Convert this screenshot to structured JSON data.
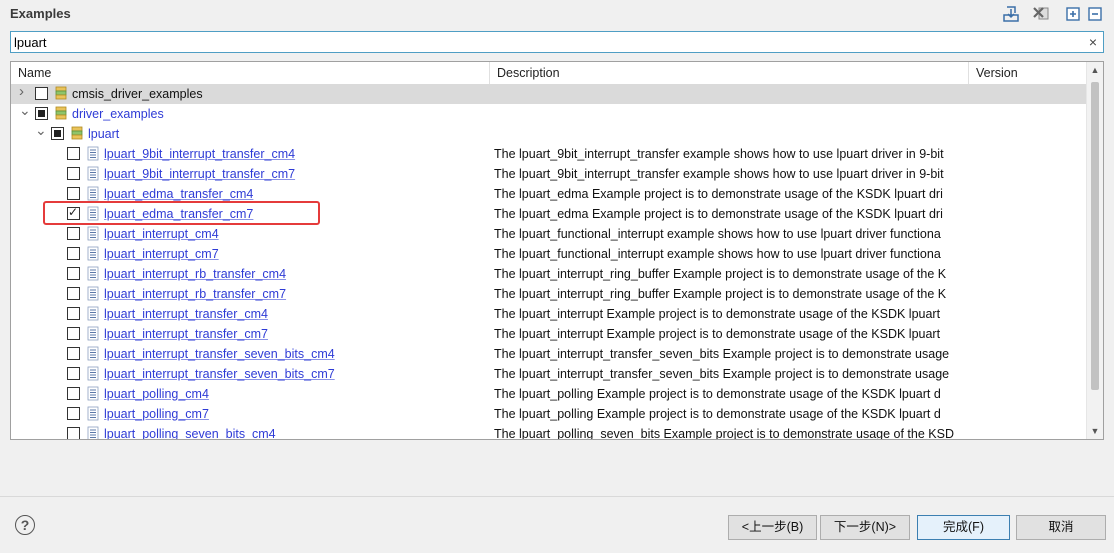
{
  "header": {
    "title": "Examples"
  },
  "search": {
    "value": "lpuart",
    "clear_icon": "×"
  },
  "columns": [
    "Name",
    "Description",
    "Version"
  ],
  "rows": [
    {
      "name": "cmsis_driver_examples",
      "description": "",
      "level": 0,
      "expander": "collapsed",
      "check": "unchecked",
      "icon": "folder-icon",
      "style": "dark",
      "selected": true
    },
    {
      "name": "driver_examples",
      "description": "",
      "level": 0,
      "expander": "expanded",
      "check": "partial",
      "icon": "folder-icon",
      "style": "blue"
    },
    {
      "name": "lpuart",
      "description": "",
      "level": 1,
      "expander": "expanded",
      "check": "partial",
      "icon": "folder-icon",
      "style": "blue"
    },
    {
      "name": "lpuart_9bit_interrupt_transfer_cm4",
      "description": "The lpuart_9bit_interrupt_transfer example shows how to use lpuart driver in 9-bit",
      "level": 2,
      "check": "unchecked",
      "icon": "file-icon",
      "style": "link"
    },
    {
      "name": "lpuart_9bit_interrupt_transfer_cm7",
      "description": "The lpuart_9bit_interrupt_transfer example shows how to use lpuart driver in 9-bit",
      "level": 2,
      "check": "unchecked",
      "icon": "file-icon",
      "style": "link"
    },
    {
      "name": "lpuart_edma_transfer_cm4",
      "description": "The lpuart_edma Example project is to demonstrate usage of the KSDK lpuart dri",
      "level": 2,
      "check": "unchecked",
      "icon": "file-icon",
      "style": "link"
    },
    {
      "name": "lpuart_edma_transfer_cm7",
      "description": "The lpuart_edma Example project is to demonstrate usage of the KSDK lpuart dri",
      "level": 2,
      "check": "checked",
      "icon": "file-icon",
      "style": "link"
    },
    {
      "name": "lpuart_interrupt_cm4",
      "description": "The lpuart_functional_interrupt example shows how to use lpuart driver functiona",
      "level": 2,
      "check": "unchecked",
      "icon": "file-icon",
      "style": "link"
    },
    {
      "name": "lpuart_interrupt_cm7",
      "description": "The lpuart_functional_interrupt example shows how to use lpuart driver functiona",
      "level": 2,
      "check": "unchecked",
      "icon": "file-icon",
      "style": "link"
    },
    {
      "name": "lpuart_interrupt_rb_transfer_cm4",
      "description": "The lpuart_interrupt_ring_buffer Example project is to demonstrate usage of the K",
      "level": 2,
      "check": "unchecked",
      "icon": "file-icon",
      "style": "link"
    },
    {
      "name": "lpuart_interrupt_rb_transfer_cm7",
      "description": "The lpuart_interrupt_ring_buffer Example project is to demonstrate usage of the K",
      "level": 2,
      "check": "unchecked",
      "icon": "file-icon",
      "style": "link"
    },
    {
      "name": "lpuart_interrupt_transfer_cm4",
      "description": "The lpuart_interrupt Example project is to demonstrate usage of the KSDK lpuart",
      "level": 2,
      "check": "unchecked",
      "icon": "file-icon",
      "style": "link"
    },
    {
      "name": "lpuart_interrupt_transfer_cm7",
      "description": "The lpuart_interrupt Example project is to demonstrate usage of the KSDK lpuart",
      "level": 2,
      "check": "unchecked",
      "icon": "file-icon",
      "style": "link"
    },
    {
      "name": "lpuart_interrupt_transfer_seven_bits_cm4",
      "description": "The lpuart_interrupt_transfer_seven_bits Example project is to demonstrate usage",
      "level": 2,
      "check": "unchecked",
      "icon": "file-icon",
      "style": "link"
    },
    {
      "name": "lpuart_interrupt_transfer_seven_bits_cm7",
      "description": "The lpuart_interrupt_transfer_seven_bits Example project is to demonstrate usage",
      "level": 2,
      "check": "unchecked",
      "icon": "file-icon",
      "style": "link"
    },
    {
      "name": "lpuart_polling_cm4",
      "description": "The lpuart_polling Example project is to demonstrate usage of the KSDK lpuart d",
      "level": 2,
      "check": "unchecked",
      "icon": "file-icon",
      "style": "link"
    },
    {
      "name": "lpuart_polling_cm7",
      "description": "The lpuart_polling Example project is to demonstrate usage of the KSDK lpuart d",
      "level": 2,
      "check": "unchecked",
      "icon": "file-icon",
      "style": "link"
    },
    {
      "name": "lpuart_polling_seven_bits_cm4",
      "description": "The lpuart_polling_seven_bits Example project is to demonstrate usage of the KSD",
      "level": 2,
      "check": "unchecked",
      "icon": "file-icon",
      "style": "link"
    }
  ],
  "footer": {
    "help": "?",
    "back": "<上一步(B)",
    "next": "下一步(N)>",
    "finish": "完成(F)",
    "cancel": "取消"
  },
  "colors": {
    "link": "#2e3bd6",
    "highlight": "#e53b3b",
    "selected_row": "#dadada"
  }
}
